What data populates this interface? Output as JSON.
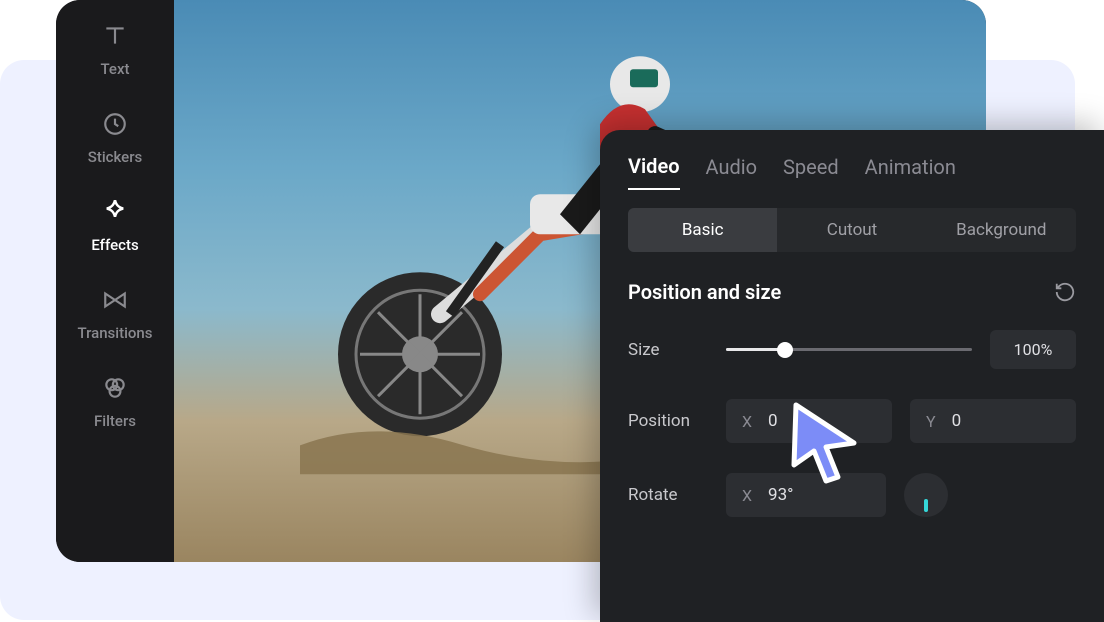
{
  "sidebar": {
    "items": [
      {
        "label": "Text",
        "icon": "text-icon",
        "active": false
      },
      {
        "label": "Stickers",
        "icon": "clock-icon",
        "active": false
      },
      {
        "label": "Effects",
        "icon": "star-icon",
        "active": true
      },
      {
        "label": "Transitions",
        "icon": "transitions-icon",
        "active": false
      },
      {
        "label": "Filters",
        "icon": "filters-icon",
        "active": false
      }
    ]
  },
  "props": {
    "top_tabs": {
      "video": "Video",
      "audio": "Audio",
      "speed": "Speed",
      "animation": "Animation",
      "active": "video"
    },
    "sub_tabs": {
      "basic": "Basic",
      "cutout": "Cutout",
      "background": "Background",
      "active": "basic"
    },
    "section_title": "Position and size",
    "size": {
      "label": "Size",
      "value": "100%",
      "slider_pct": 24
    },
    "position": {
      "label": "Position",
      "x_label": "X",
      "x_value": "0",
      "y_label": "Y",
      "y_value": "0"
    },
    "rotate": {
      "label": "Rotate",
      "x_label": "X",
      "x_value": "93°"
    }
  }
}
